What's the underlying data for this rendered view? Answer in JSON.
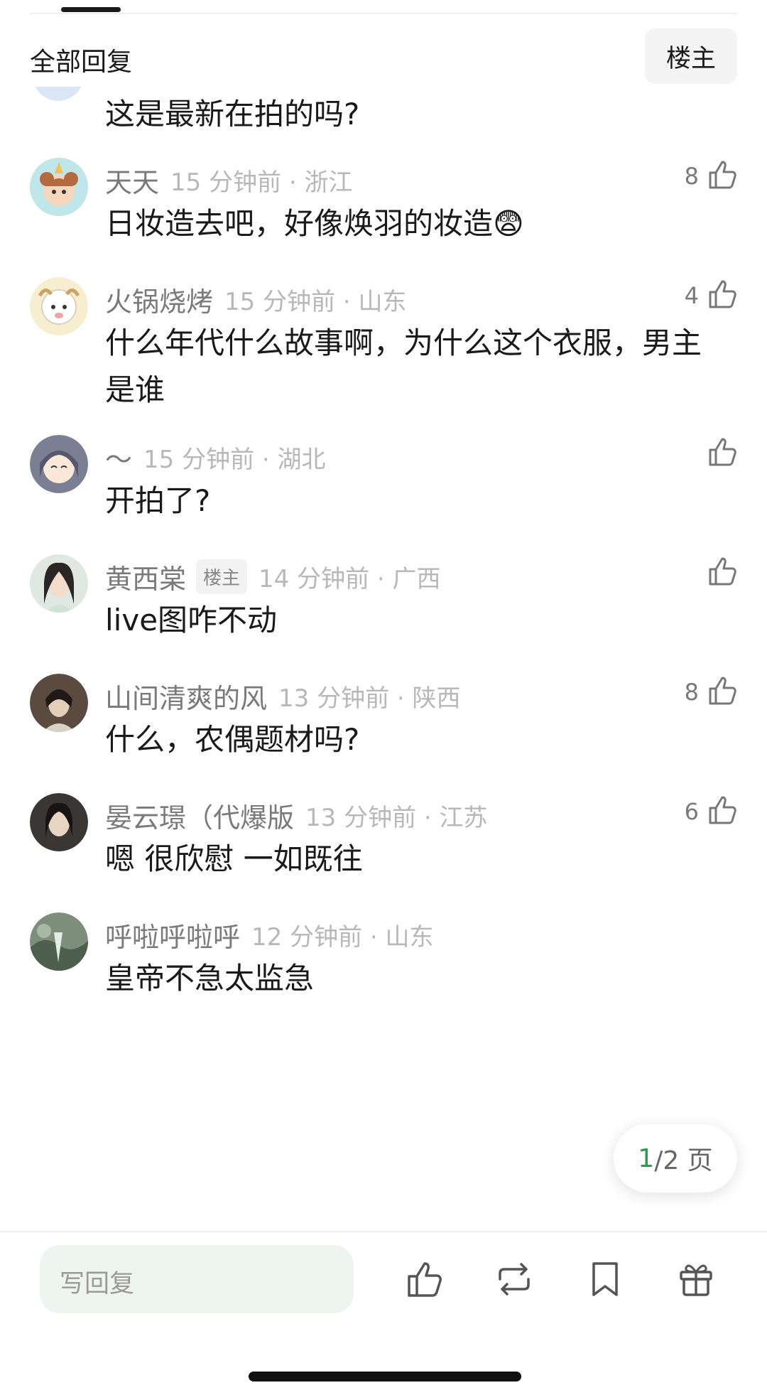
{
  "header": {
    "title": "全部回复",
    "owner_filter": "楼主"
  },
  "top_comment": {
    "text": "这是最新在拍的吗?"
  },
  "comments": [
    {
      "name": "天天",
      "time": "15 分钟前 · 浙江",
      "text": "日妆造去吧，好像焕羽的妆造😨",
      "likes": "8"
    },
    {
      "name": "火锅烧烤",
      "time": "15 分钟前 · 山东",
      "text": "什么年代什么故事啊，为什么这个衣服，男主是谁",
      "likes": "4"
    },
    {
      "name": "～",
      "time": "15 分钟前 · 湖北",
      "text": "开拍了?",
      "likes": ""
    },
    {
      "name": "黄西棠",
      "badge": "楼主",
      "time": "14 分钟前 · 广西",
      "text": "live图咋不动",
      "likes": ""
    },
    {
      "name": "山间清爽的风",
      "time": "13 分钟前 · 陕西",
      "text": "什么，农偶题材吗?",
      "likes": "8"
    },
    {
      "name": "晏云璟（代爆版",
      "time": "13 分钟前 · 江苏",
      "text": "嗯 很欣慰 一如既往",
      "likes": "6"
    },
    {
      "name": "呼啦呼啦呼",
      "time": "12 分钟前 · 山东",
      "text": "皇帝不急太监急",
      "likes": ""
    }
  ],
  "pagination": {
    "current": "1",
    "rest": "/2 页"
  },
  "bottom_bar": {
    "reply_placeholder": "写回复"
  },
  "colors": {
    "accent": "#2a9d4a",
    "reply_box": "#eef5f0"
  }
}
